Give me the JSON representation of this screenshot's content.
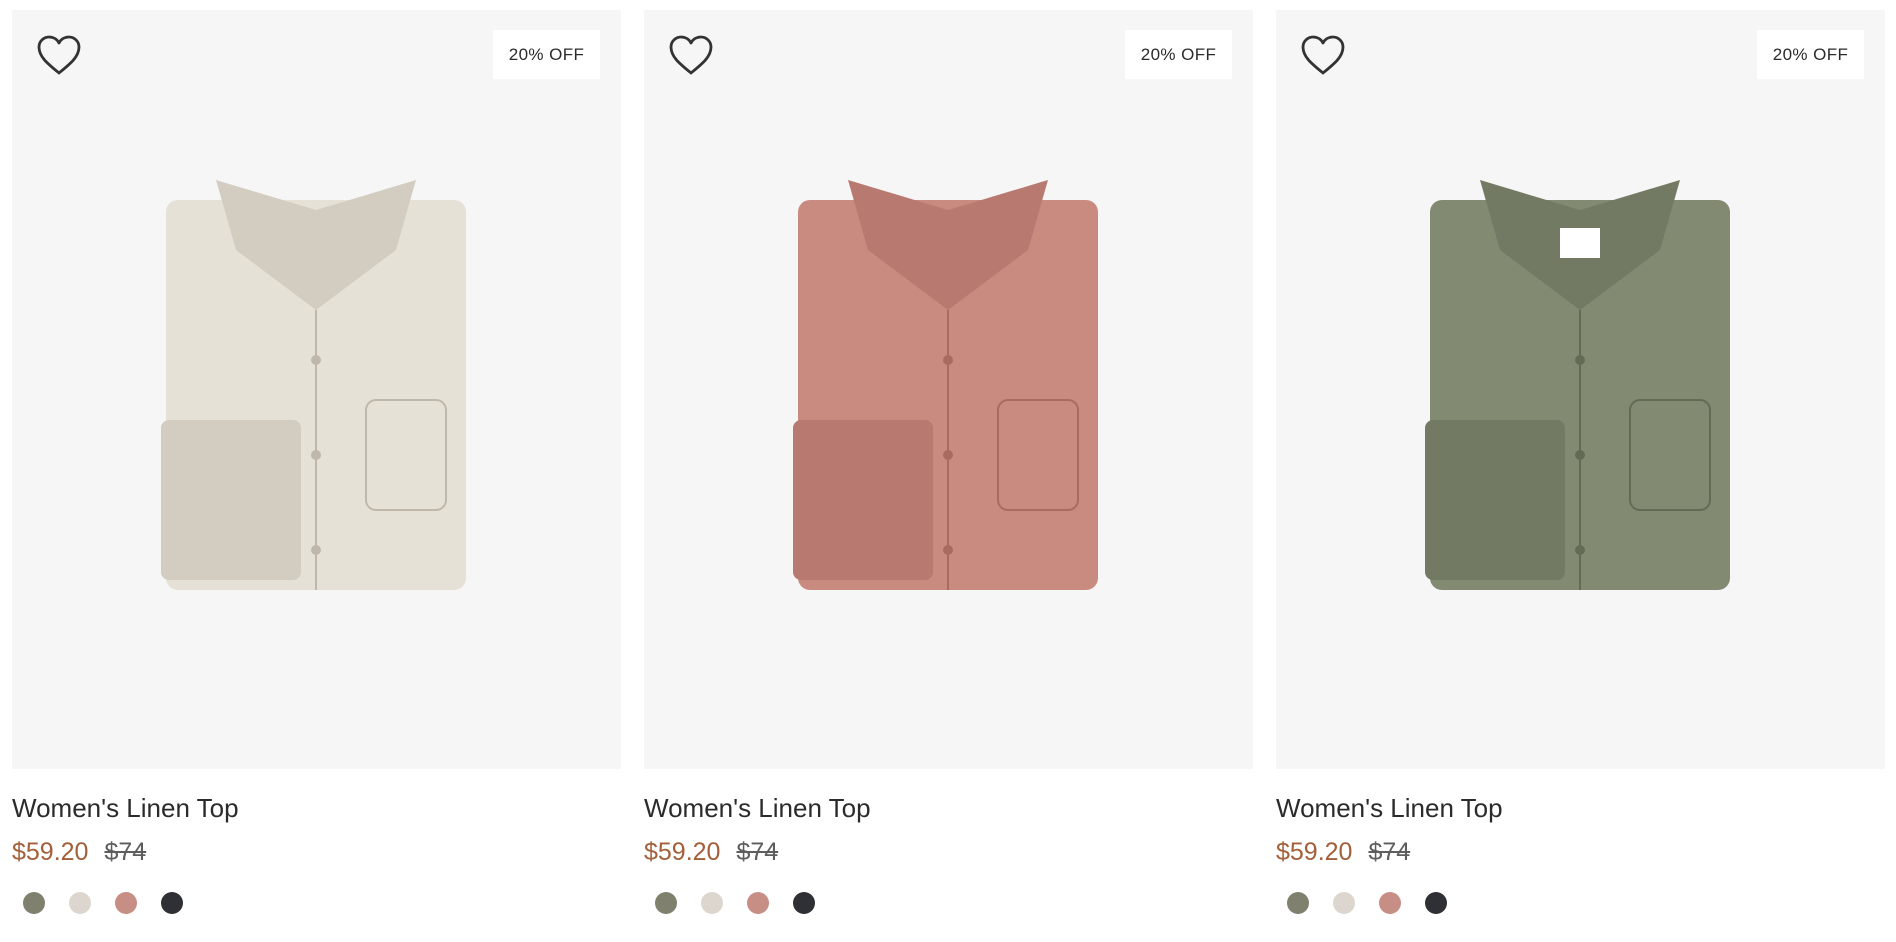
{
  "products": [
    {
      "badge": "20% OFF",
      "title": "Women's Linen Top",
      "sale_price": "$59.20",
      "original_price": "$74",
      "shirt_color": "#e6e1d7",
      "shirt_shade": "#d3cdc1",
      "shirt_line": "#bfb8aa",
      "wishlist_icon": "heart-outline-icon",
      "swatches": [
        "#7f806d",
        "#dcd6ce",
        "#c78e85",
        "#2f3035"
      ]
    },
    {
      "badge": "20% OFF",
      "title": "Women's Linen Top",
      "sale_price": "$59.20",
      "original_price": "$74",
      "shirt_color": "#c98b80",
      "shirt_shade": "#b87a70",
      "shirt_line": "#a86b62",
      "wishlist_icon": "heart-outline-icon",
      "swatches": [
        "#7f806d",
        "#dcd6ce",
        "#c78e85",
        "#2f3035"
      ]
    },
    {
      "badge": "20% OFF",
      "title": "Women's Linen Top",
      "sale_price": "$59.20",
      "original_price": "$74",
      "shirt_color": "#838a72",
      "shirt_shade": "#737a63",
      "shirt_line": "#646b55",
      "wishlist_icon": "heart-outline-icon",
      "swatches": [
        "#7f806d",
        "#dcd6ce",
        "#c78e85",
        "#2f3035"
      ]
    }
  ]
}
